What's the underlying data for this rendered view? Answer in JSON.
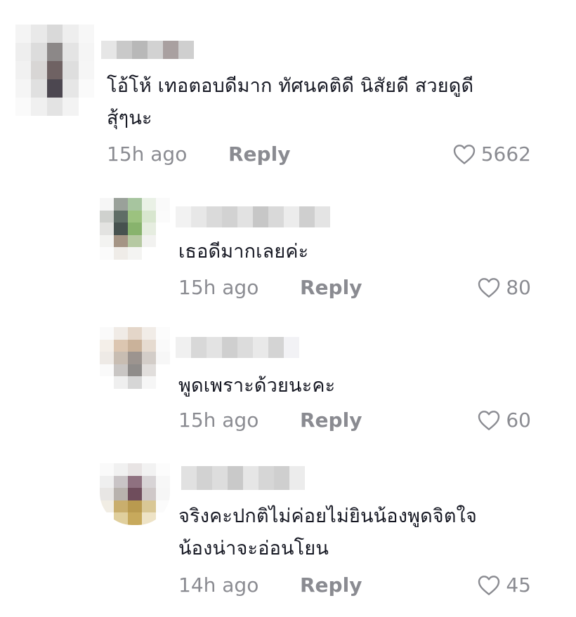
{
  "colors": {
    "text_primary": "#161823",
    "text_secondary": "#8a8b91",
    "background": "#ffffff"
  },
  "icons": {
    "like": "heart-outline-icon"
  },
  "comments": [
    {
      "text": "โอ้โห้ เทอตอบดีมาก ทัศนคติดี นิสัยดี สวยดูดี\nสุ้ๆนะ",
      "time": "15h ago",
      "reply_label": "Reply",
      "likes": "5662"
    },
    {
      "text": "เธอดีมากเลยค่ะ",
      "time": "15h ago",
      "reply_label": "Reply",
      "likes": "80"
    },
    {
      "text": "พูดเพราะด้วยนะคะ",
      "time": "15h ago",
      "reply_label": "Reply",
      "likes": "60"
    },
    {
      "text": "จริงคะปกติไม่ค่อยไม่ยินน้องพูดจิตใจ\nน้องน่าจะอ่อนโยน",
      "time": "14h ago",
      "reply_label": "Reply",
      "likes": "45"
    }
  ]
}
